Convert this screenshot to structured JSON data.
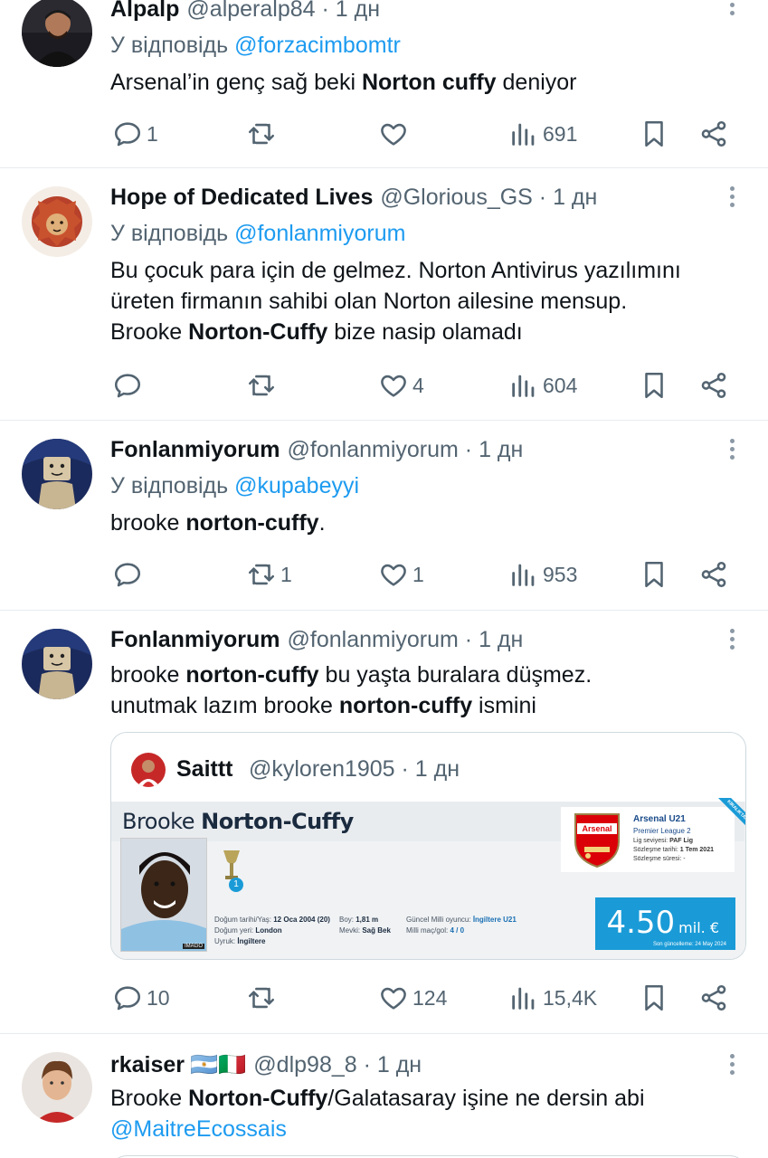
{
  "tweets": [
    {
      "name": "Alpalp",
      "handle": "@alperalp84",
      "time": " · 1 дн",
      "reply_prefix": "У відповідь ",
      "reply_to": "@forzacimbomtr",
      "text_parts": [
        "Arsenal’in genç sağ beki ",
        "Norton cuffy",
        " deniyor"
      ],
      "replies": "1",
      "retweets": "",
      "likes": "",
      "views": "691"
    },
    {
      "name": "Hope of Dedicated Lives",
      "handle": "@Glorious_GS",
      "time": " · 1 дн",
      "reply_prefix": "У відповідь ",
      "reply_to": "@fonlanmiyorum",
      "line1": "Bu çocuk para için de gelmez. Norton Antivirus yazılımını",
      "line2": "üreten firmanın sahibi olan Norton ailesine mensup.",
      "line3_a": "Brooke ",
      "line3_b": "Norton-Cuffy",
      "line3_c": " bize nasip olamadı",
      "replies": "",
      "retweets": "",
      "likes": "4",
      "views": "604"
    },
    {
      "name": "Fonlanmiyorum",
      "handle": "@fonlanmiyorum",
      "time": " · 1 дн",
      "reply_prefix": "У відповідь ",
      "reply_to": "@kupabeyyi",
      "text_a": "brooke ",
      "text_b": "norton-cuffy",
      "text_c": ".",
      "replies": "",
      "retweets": "1",
      "likes": "1",
      "views": "953"
    },
    {
      "name": "Fonlanmiyorum",
      "handle": "@fonlanmiyorum",
      "time": " · 1 дн",
      "line1_a": "brooke ",
      "line1_b": "norton-cuffy",
      "line1_c": " bu yaşta buralara düşmez.",
      "line2_a": "unutmak lazım brooke ",
      "line2_b": "norton-cuffy",
      "line2_c": " ismini",
      "quote": {
        "name": "Saittt",
        "handle": "@kyloren1905",
        "time": " · 1 дн",
        "card": {
          "first": "Brooke ",
          "last": "Norton-Cuffy",
          "club": "Arsenal U21",
          "league": "Premier League 2",
          "lig_seviyesi": "Lig seviyesi: ",
          "lig_val": "PAF Lig",
          "sozlesme": "Sözleşme tarihi: ",
          "sozlesme_val": "1 Tem 2021",
          "sure": "Sözleşme süresi: -",
          "dogum": "Doğum tarihi/Yaş: ",
          "dogum_val": "12 Oca 2004 (20)",
          "dogum_yeri": "Doğum yeri: ",
          "dogum_yeri_val": "London",
          "uyruk": "Uyruk: ",
          "uyruk_val": "İngiltere",
          "boy": "Boy: ",
          "boy_val": "1,81 m",
          "mevki": "Mevki: ",
          "mevki_val": "Sağ Bek",
          "milli": "Güncel Milli oyuncu: ",
          "milli_val": "İngiltere U21",
          "mac": "Milli maç/gol: ",
          "mac_val": "4 / 0",
          "value": "4.50",
          "unit": "mil. €",
          "updated": "Son güncelleme: 24 May 2024",
          "ribbon": "KİRALIKTAN DÖNÜŞ",
          "crest": "Arsenal",
          "badge_num": "1",
          "imago": "IMAGO"
        }
      },
      "replies": "10",
      "retweets": "",
      "likes": "124",
      "views": "15,4K"
    },
    {
      "name": "rkaiser",
      "flags": "🇦🇷🇮🇹",
      "handle": "@dlp98_8",
      "time": " · 1 дн",
      "text_a": "Brooke ",
      "text_b": "Norton-Cuffy",
      "text_c": "/Galatasaray işine ne dersin abi",
      "mention": "@MaitreEcossais"
    }
  ],
  "icons": {
    "reply": "comment-bubble-icon",
    "retweet": "retweet-icon",
    "like": "heart-icon",
    "views": "views-chart-icon",
    "bookmark": "bookmark-icon",
    "share": "share-icon",
    "more": "more-dots-icon"
  },
  "colors": {
    "accent": "#1d9bf0",
    "secondary_text": "#536471",
    "divider": "#e6ecf0",
    "value_box": "#1a9bd7"
  }
}
